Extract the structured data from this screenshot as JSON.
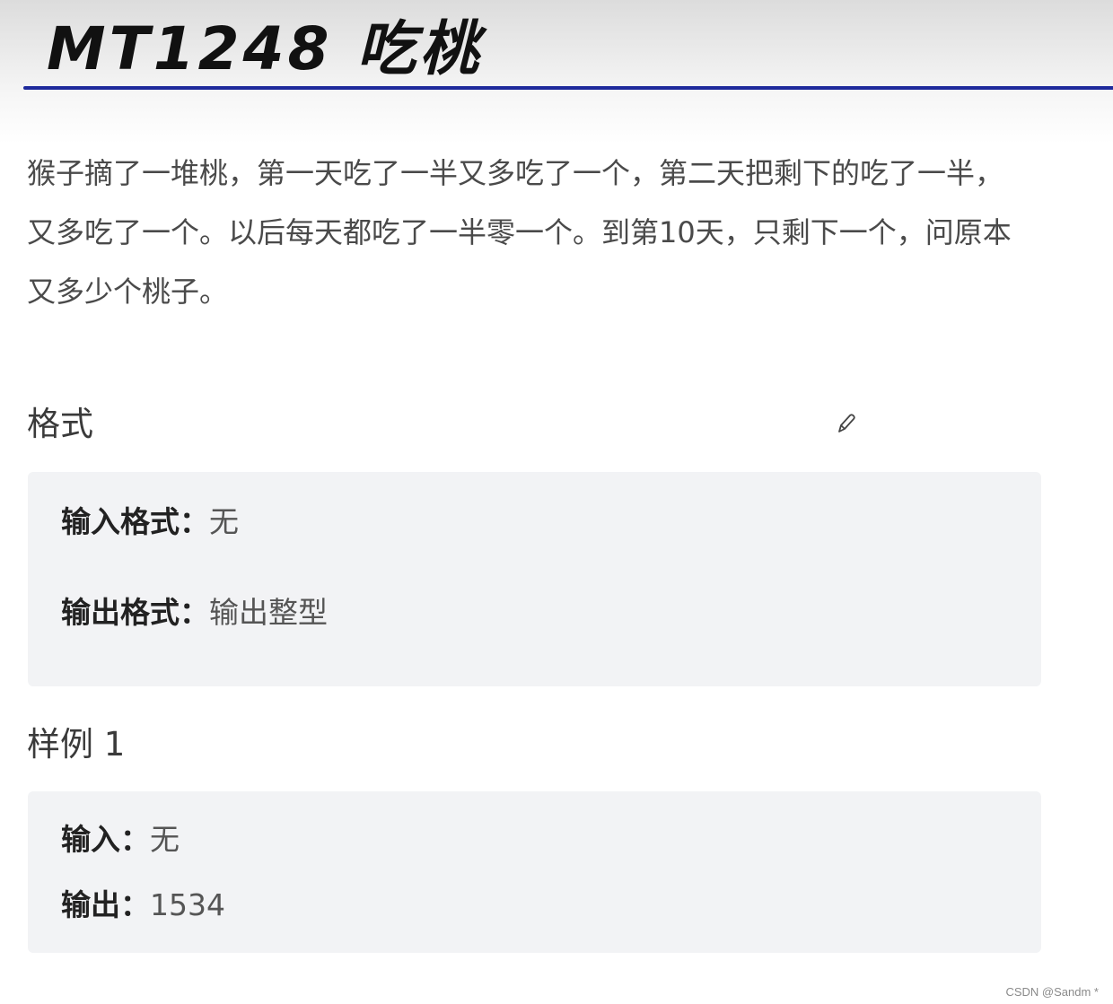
{
  "header": {
    "title": "MT1248 吃桃"
  },
  "description": "猴子摘了一堆桃，第一天吃了一半又多吃了一个，第二天把剩下的吃了一半，又多吃了一个。以后每天都吃了一半零一个。到第10天，只剩下一个，问原本又多少个桃子。",
  "format_section": {
    "title": "格式",
    "edit_icon": "pencil-icon",
    "input_label": "输入格式：",
    "input_value": "无",
    "output_label": "输出格式：",
    "output_value": "输出整型"
  },
  "sample_section": {
    "title": "样例 1",
    "input_label": "输入：",
    "input_value": "无",
    "output_label": "输出：",
    "output_value": "1534"
  },
  "watermark": "CSDN @Sandm *",
  "colors": {
    "title_rule": "#1e2a9c",
    "panel_background": "#f2f3f5"
  }
}
